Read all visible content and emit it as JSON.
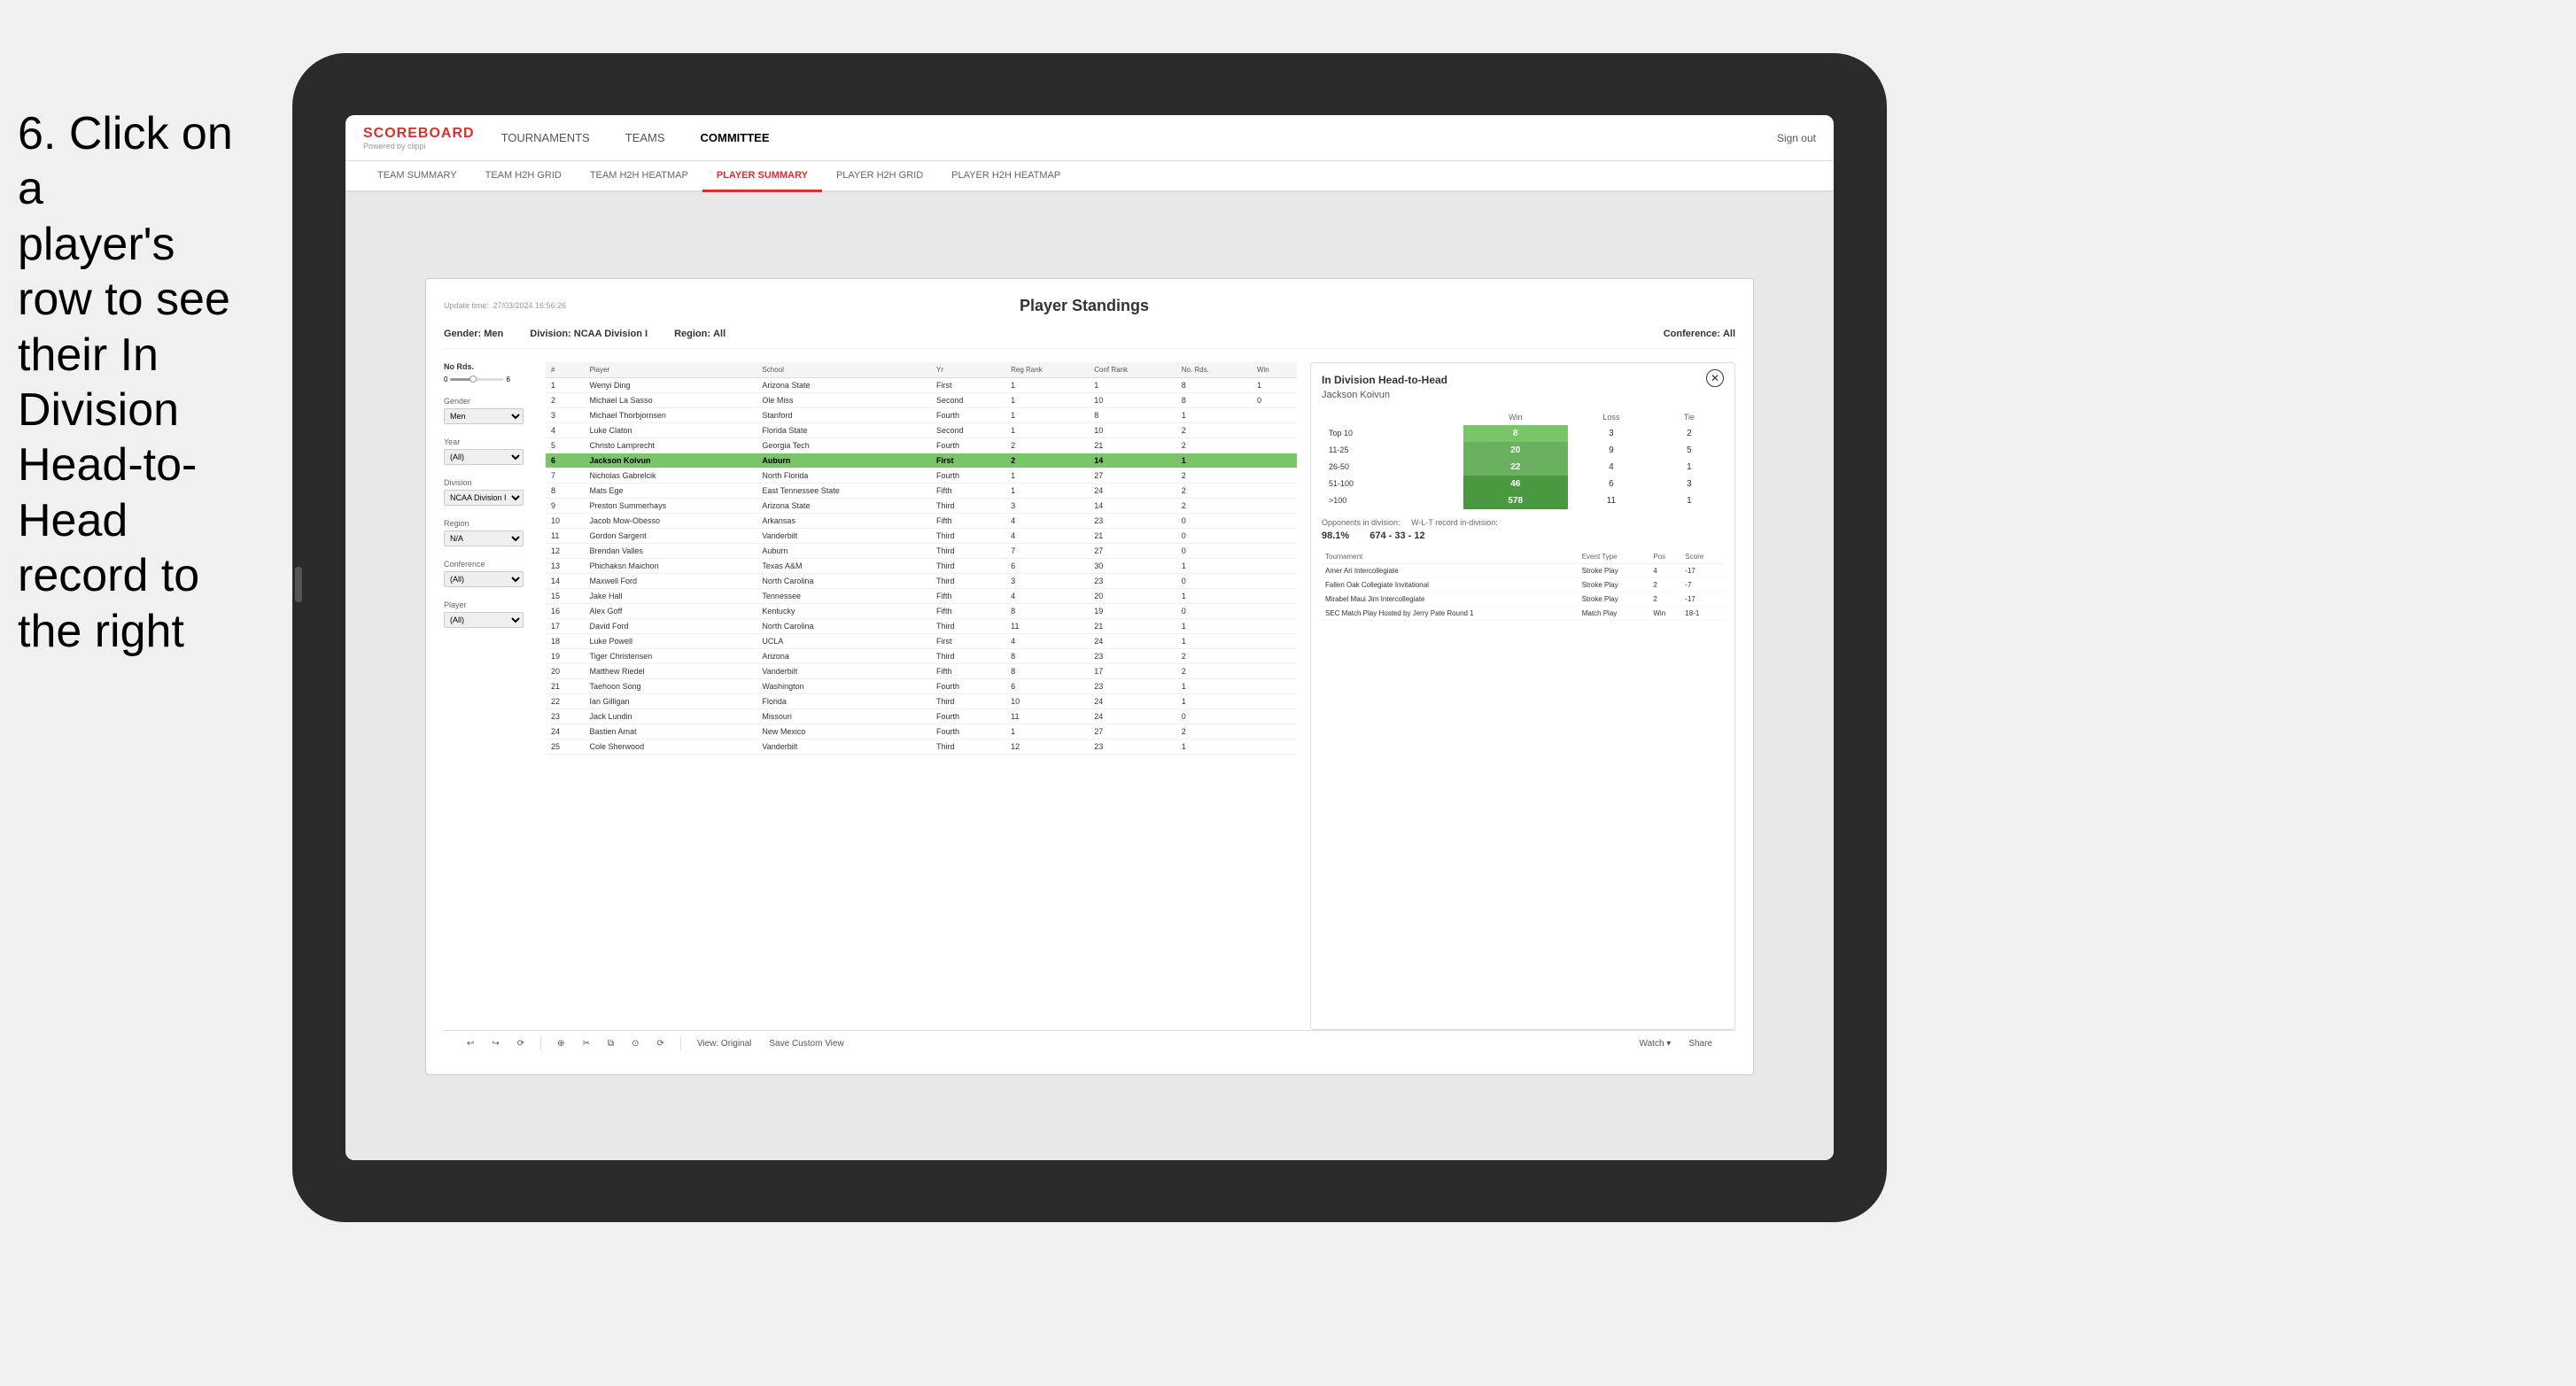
{
  "instruction": {
    "line1": "6. Click on a",
    "line2": "player's row to see",
    "line3": "their In Division",
    "line4": "Head-to-Head",
    "line5": "record to the right"
  },
  "nav": {
    "logo": "SCOREBOARD",
    "logo_sub": "Powered by clippi",
    "items": [
      "TOURNAMENTS",
      "TEAMS",
      "COMMITTEE"
    ],
    "sign_out": "Sign out"
  },
  "sub_nav": {
    "items": [
      "TEAM SUMMARY",
      "TEAM H2H GRID",
      "TEAM H2H HEATMAP",
      "PLAYER SUMMARY",
      "PLAYER H2H GRID",
      "PLAYER H2H HEATMAP"
    ],
    "active": "PLAYER SUMMARY"
  },
  "card": {
    "update_label": "Update time:",
    "update_time": "27/03/2024 16:56:26",
    "title": "Player Standings",
    "filters": {
      "gender_label": "Gender:",
      "gender_value": "Men",
      "division_label": "Division:",
      "division_value": "NCAA Division I",
      "region_label": "Region:",
      "region_value": "All",
      "conference_label": "Conference:",
      "conference_value": "All"
    }
  },
  "left_filters": {
    "no_rds_label": "No Rds.",
    "no_rds_range": "6",
    "slider_min": "0",
    "gender_label": "Gender",
    "gender_value": "Men",
    "year_label": "Year",
    "year_value": "(All)",
    "division_label": "Division",
    "division_value": "NCAA Division I",
    "region_label": "Region",
    "region_value": "N/A",
    "conference_label": "Conference",
    "conference_value": "(All)",
    "player_label": "Player",
    "player_value": "(All)"
  },
  "table": {
    "headers": [
      "#",
      "Player",
      "School",
      "Yr",
      "Reg Rank",
      "Conf Rank",
      "No. Rds.",
      "Win"
    ],
    "rows": [
      {
        "num": "1",
        "player": "Wenyi Ding",
        "school": "Arizona State",
        "yr": "First",
        "reg_rank": "1",
        "conf_rank": "1",
        "rds": "8",
        "win": "1"
      },
      {
        "num": "2",
        "player": "Michael La Sasso",
        "school": "Ole Miss",
        "yr": "Second",
        "reg_rank": "1",
        "conf_rank": "10",
        "rds": "8",
        "win": "0"
      },
      {
        "num": "3",
        "player": "Michael Thorbjornsen",
        "school": "Stanford",
        "yr": "Fourth",
        "reg_rank": "1",
        "conf_rank": "8",
        "rds": "1"
      },
      {
        "num": "4",
        "player": "Luke Claton",
        "school": "Florida State",
        "yr": "Second",
        "reg_rank": "1",
        "conf_rank": "10",
        "rds": "2"
      },
      {
        "num": "5",
        "player": "Christo Lamprecht",
        "school": "Georgia Tech",
        "yr": "Fourth",
        "reg_rank": "2",
        "conf_rank": "21",
        "rds": "2"
      },
      {
        "num": "6",
        "player": "Jackson Koivun",
        "school": "Auburn",
        "yr": "First",
        "reg_rank": "2",
        "conf_rank": "14",
        "rds": "1",
        "highlighted": true
      },
      {
        "num": "7",
        "player": "Nicholas Gabrelcik",
        "school": "North Florida",
        "yr": "Fourth",
        "reg_rank": "1",
        "conf_rank": "27",
        "rds": "2"
      },
      {
        "num": "8",
        "player": "Mats Ege",
        "school": "East Tennessee State",
        "yr": "Fifth",
        "reg_rank": "1",
        "conf_rank": "24",
        "rds": "2"
      },
      {
        "num": "9",
        "player": "Preston Summerhays",
        "school": "Arizona State",
        "yr": "Third",
        "reg_rank": "3",
        "conf_rank": "14",
        "rds": "2"
      },
      {
        "num": "10",
        "player": "Jacob Mow-Obesso",
        "school": "Arkansas",
        "yr": "Fifth",
        "reg_rank": "4",
        "conf_rank": "23",
        "rds": "0"
      },
      {
        "num": "11",
        "player": "Gordon Sargent",
        "school": "Vanderbilt",
        "yr": "Third",
        "reg_rank": "4",
        "conf_rank": "21",
        "rds": "0"
      },
      {
        "num": "12",
        "player": "Brendan Valles",
        "school": "Auburn",
        "yr": "Third",
        "reg_rank": "7",
        "conf_rank": "27",
        "rds": "0"
      },
      {
        "num": "13",
        "player": "Phichaksn Maichon",
        "school": "Texas A&M",
        "yr": "Third",
        "reg_rank": "6",
        "conf_rank": "30",
        "rds": "1"
      },
      {
        "num": "14",
        "player": "Maxwell Ford",
        "school": "North Carolina",
        "yr": "Third",
        "reg_rank": "3",
        "conf_rank": "23",
        "rds": "0"
      },
      {
        "num": "15",
        "player": "Jake Hall",
        "school": "Tennessee",
        "yr": "Fifth",
        "reg_rank": "4",
        "conf_rank": "20",
        "rds": "1"
      },
      {
        "num": "16",
        "player": "Alex Goff",
        "school": "Kentucky",
        "yr": "Fifth",
        "reg_rank": "8",
        "conf_rank": "19",
        "rds": "0"
      },
      {
        "num": "17",
        "player": "David Ford",
        "school": "North Carolina",
        "yr": "Third",
        "reg_rank": "11",
        "conf_rank": "21",
        "rds": "1"
      },
      {
        "num": "18",
        "player": "Luke Powell",
        "school": "UCLA",
        "yr": "First",
        "reg_rank": "4",
        "conf_rank": "24",
        "rds": "1"
      },
      {
        "num": "19",
        "player": "Tiger Christensen",
        "school": "Arizona",
        "yr": "Third",
        "reg_rank": "8",
        "conf_rank": "23",
        "rds": "2"
      },
      {
        "num": "20",
        "player": "Matthew Riedel",
        "school": "Vanderbilt",
        "yr": "Fifth",
        "reg_rank": "8",
        "conf_rank": "17",
        "rds": "2"
      },
      {
        "num": "21",
        "player": "Taehoon Song",
        "school": "Washington",
        "yr": "Fourth",
        "reg_rank": "6",
        "conf_rank": "23",
        "rds": "1"
      },
      {
        "num": "22",
        "player": "Ian Gilligan",
        "school": "Florida",
        "yr": "Third",
        "reg_rank": "10",
        "conf_rank": "24",
        "rds": "1"
      },
      {
        "num": "23",
        "player": "Jack Lundin",
        "school": "Missouri",
        "yr": "Fourth",
        "reg_rank": "11",
        "conf_rank": "24",
        "rds": "0"
      },
      {
        "num": "24",
        "player": "Bastien Amat",
        "school": "New Mexico",
        "yr": "Fourth",
        "reg_rank": "1",
        "conf_rank": "27",
        "rds": "2"
      },
      {
        "num": "25",
        "player": "Cole Sherwood",
        "school": "Vanderbilt",
        "yr": "Third",
        "reg_rank": "12",
        "conf_rank": "23",
        "rds": "1"
      }
    ]
  },
  "h2h": {
    "title": "In Division Head-to-Head",
    "player_name": "Jackson Koivun",
    "close_icon": "✕",
    "table_headers": [
      "",
      "Win",
      "Loss",
      "Tie"
    ],
    "rows": [
      {
        "label": "Top 10",
        "win": "8",
        "loss": "3",
        "tie": "2",
        "win_shade": "light"
      },
      {
        "label": "11-25",
        "win": "20",
        "loss": "9",
        "tie": "5",
        "win_shade": "mid"
      },
      {
        "label": "26-50",
        "win": "22",
        "loss": "4",
        "tie": "1",
        "win_shade": "mid"
      },
      {
        "label": "51-100",
        "win": "46",
        "loss": "6",
        "tie": "3",
        "win_shade": "dark"
      },
      {
        "label": ">100",
        "win": "578",
        "loss": "11",
        "tie": "1",
        "win_shade": "dark"
      }
    ],
    "opponents_label": "Opponents in division:",
    "wl_label": "W-L-T record in-division:",
    "opponents_pct": "98.1%",
    "record": "674 - 33 - 12",
    "tournament_headers": [
      "Tournament",
      "Event Type",
      "Pos",
      "Score"
    ],
    "tournaments": [
      {
        "name": "Amer Ari Intercollegiate",
        "type": "Stroke Play",
        "pos": "4",
        "score": "-17"
      },
      {
        "name": "Fallen Oak Collegiate Invitational",
        "type": "Stroke Play",
        "pos": "2",
        "score": "-7"
      },
      {
        "name": "Mirabel Maui Jim Intercollegiate",
        "type": "Stroke Play",
        "pos": "2",
        "score": "-17"
      },
      {
        "name": "SEC Match Play Hosted by Jerry Pate Round 1",
        "type": "Match Play",
        "pos": "Win",
        "score": "18-1"
      }
    ]
  },
  "toolbar": {
    "buttons": [
      "↩",
      "↪",
      "⟳",
      "⊕",
      "✂",
      "⧉",
      "⊙",
      "⟳"
    ],
    "view_original": "View: Original",
    "save_custom": "Save Custom View",
    "watch": "Watch ▾",
    "share": "Share"
  }
}
